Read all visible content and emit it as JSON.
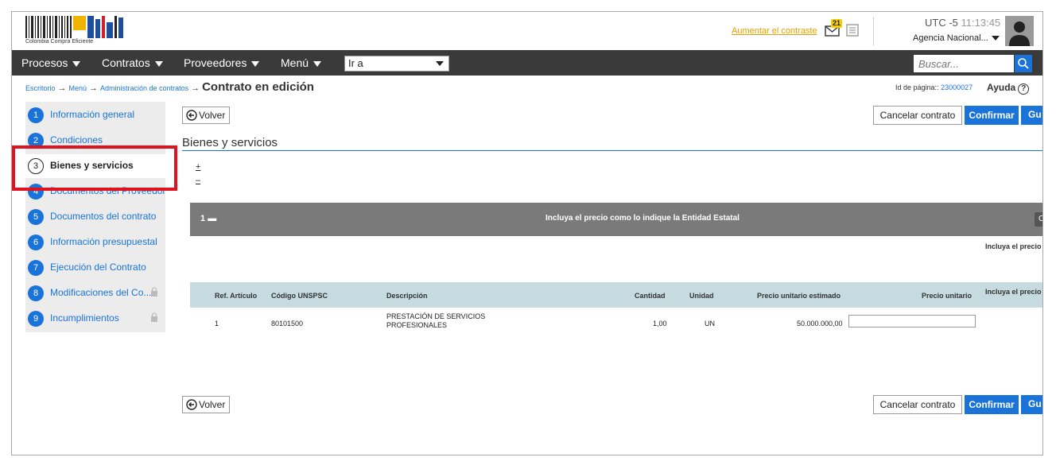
{
  "header": {
    "logo_text": "Colombia Compra Eficiente",
    "contrast_link": "Aumentar el contraste",
    "mail_badge": "21",
    "timezone_label": "UTC -5",
    "time": "11:13:45",
    "entity": "Agencia Nacional..."
  },
  "nav": {
    "items": [
      "Procesos",
      "Contratos",
      "Proveedores",
      "Menú"
    ],
    "goto_label": "Ir a",
    "search_placeholder": "Buscar..."
  },
  "breadcrumb": {
    "items": [
      "Escritorio",
      "Menú",
      "Administración de contratos"
    ],
    "current": "Contrato en edición",
    "page_id_label": "Id de página::",
    "page_id": "23000027",
    "help": "Ayuda"
  },
  "sidebar": {
    "steps": [
      {
        "num": "1",
        "label": "Información general"
      },
      {
        "num": "2",
        "label": "Condiciones"
      },
      {
        "num": "3",
        "label": "Bienes y servicios"
      },
      {
        "num": "4",
        "label": "Documentos del Proveedor"
      },
      {
        "num": "5",
        "label": "Documentos del contrato"
      },
      {
        "num": "6",
        "label": "Información presupuestal"
      },
      {
        "num": "7",
        "label": "Ejecución del Contrato"
      },
      {
        "num": "8",
        "label": "Modificaciones del Co..."
      },
      {
        "num": "9",
        "label": "Incumplimientos"
      }
    ],
    "active_step": 3
  },
  "actions": {
    "back": "Volver",
    "cancel": "Cancelar contrato",
    "confirm": "Confirmar",
    "save": "Gu"
  },
  "section": {
    "title": "Bienes y servicios",
    "expand": "+",
    "collapse": "–"
  },
  "group": {
    "number": "1",
    "title": "Incluya el precio como lo indique la Entidad Estatal",
    "button": "C",
    "right_note": "Incluya el precio"
  },
  "table": {
    "columns": [
      "Ref. Artículo",
      "Código UNSPSC",
      "Descripción",
      "Cantidad",
      "Unidad",
      "Precio unitario estimado",
      "Precio unitario",
      "Incluya el precio"
    ],
    "rows": [
      {
        "ref": "1",
        "code": "80101500",
        "description_line1": "PRESTACIÓN DE SERVICIOS",
        "description_line2": "PROFESIONALES",
        "quantity": "1,00",
        "unit": "UN",
        "estimated_price": "50.000.000,00",
        "unit_price": ""
      }
    ]
  },
  "colors": {
    "accent": "#1a73d9",
    "navbar": "#3a3a3a",
    "highlight": "#e0141e",
    "group_bar": "#7a7a7a",
    "table_header": "#c5dbe0"
  }
}
